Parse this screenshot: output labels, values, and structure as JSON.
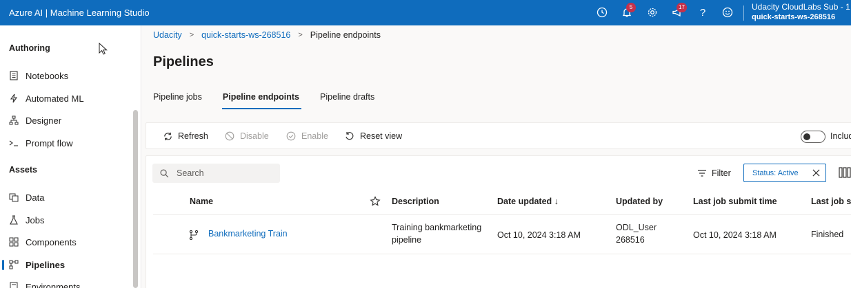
{
  "app": {
    "title": "Azure AI | Machine Learning Studio"
  },
  "topbar": {
    "notifications_badge": "5",
    "feedback_badge": "17",
    "account_tenant": "Udacity CloudLabs Sub - 1",
    "account_workspace": "quick-starts-ws-268516"
  },
  "sidebar": {
    "authoring_heading": "Authoring",
    "assets_heading": "Assets",
    "authoring_items": [
      {
        "label": "Notebooks",
        "icon": "notebook-icon"
      },
      {
        "label": "Automated ML",
        "icon": "automl-icon"
      },
      {
        "label": "Designer",
        "icon": "designer-icon"
      },
      {
        "label": "Prompt flow",
        "icon": "prompt-flow-icon"
      }
    ],
    "asset_items": [
      {
        "label": "Data",
        "icon": "data-icon"
      },
      {
        "label": "Jobs",
        "icon": "jobs-icon"
      },
      {
        "label": "Components",
        "icon": "components-icon"
      },
      {
        "label": "Pipelines",
        "icon": "pipelines-icon",
        "active": true
      },
      {
        "label": "Environments",
        "icon": "environments-icon"
      }
    ]
  },
  "breadcrumb": [
    "Udacity",
    "quick-starts-ws-268516",
    "Pipeline endpoints"
  ],
  "page": {
    "title": "Pipelines"
  },
  "tabs": [
    {
      "label": "Pipeline jobs",
      "active": false
    },
    {
      "label": "Pipeline endpoints",
      "active": true
    },
    {
      "label": "Pipeline drafts",
      "active": false
    }
  ],
  "toolbar": {
    "refresh": "Refresh",
    "disable": "Disable",
    "enable": "Enable",
    "reset_view": "Reset view",
    "include_label": "Include"
  },
  "list": {
    "search_placeholder": "Search",
    "filter_label": "Filter",
    "status_chip": "Status: Active",
    "columns": [
      "Name",
      "Description",
      "Date updated ↓",
      "Updated by",
      "Last job submit time",
      "Last job status"
    ],
    "rows": [
      {
        "name": "Bankmarketing Train",
        "description_line1": "Training bankmarketing",
        "description_line2": "pipeline",
        "date_updated": "Oct 10, 2024 3:18 AM",
        "updated_by_line1": "ODL_User",
        "updated_by_line2": "268516",
        "last_submit": "Oct 10, 2024 3:18 AM",
        "last_status": "Finished"
      }
    ]
  },
  "colors": {
    "brand": "#0f6cbd",
    "badge": "#c4314b"
  }
}
